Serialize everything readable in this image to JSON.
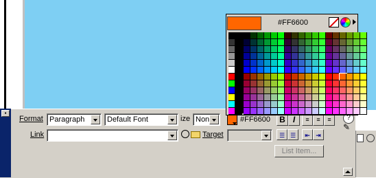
{
  "inspector": {
    "format_label": "Format",
    "format_value": "Paragraph",
    "font_value": "Default Font",
    "size_label": "ize",
    "size_value": "Non",
    "color_hex": "#FF6600",
    "bold_label": "B",
    "italic_label": "I",
    "link_label": "Link",
    "link_value": "",
    "target_label": "Target",
    "target_value": "",
    "list_item_label": "List Item...",
    "help_label": "?"
  },
  "picker": {
    "hex": "#FF6600",
    "selected_color": "#FF6600",
    "no_color_icon": "no-color-icon",
    "system_color_icon": "color-wheel-icon",
    "menu_icon": "triangle-right-icon"
  },
  "colors": {
    "canvas": "#7ECFF3",
    "panel": "#D4D0C8",
    "titlebar": "#0A246A",
    "accent": "#FF6600"
  }
}
